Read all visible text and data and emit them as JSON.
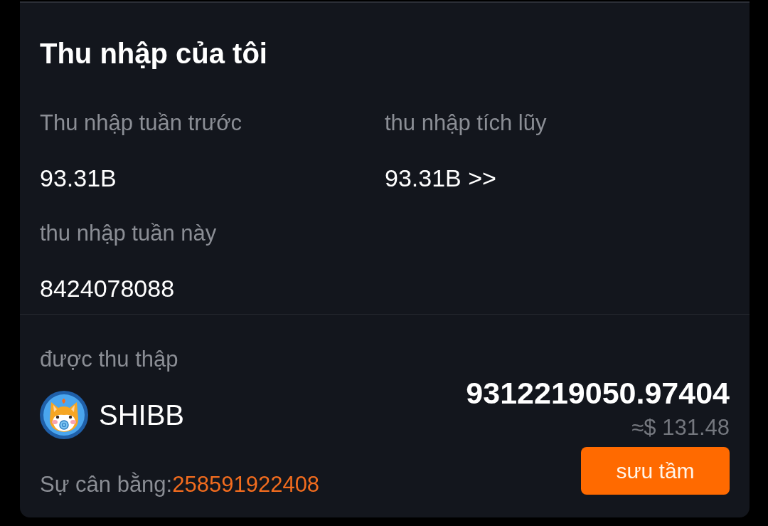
{
  "card": {
    "title": "Thu nhập của tôi",
    "stats": [
      {
        "label": "Thu nhập tuần trước",
        "value": "93.31B"
      },
      {
        "label": "thu nhập tích lũy",
        "value": "93.31B >>"
      },
      {
        "label": "thu nhập tuần này",
        "value": "8424078088"
      }
    ]
  },
  "collected": {
    "label": "được thu thập",
    "token": "SHIBB",
    "amount": "9312219050.97404",
    "usd": "≈$ 131.48",
    "button": "sưu tầm",
    "balance_label": "Sự cân bằng:",
    "balance_value": "258591922408"
  }
}
